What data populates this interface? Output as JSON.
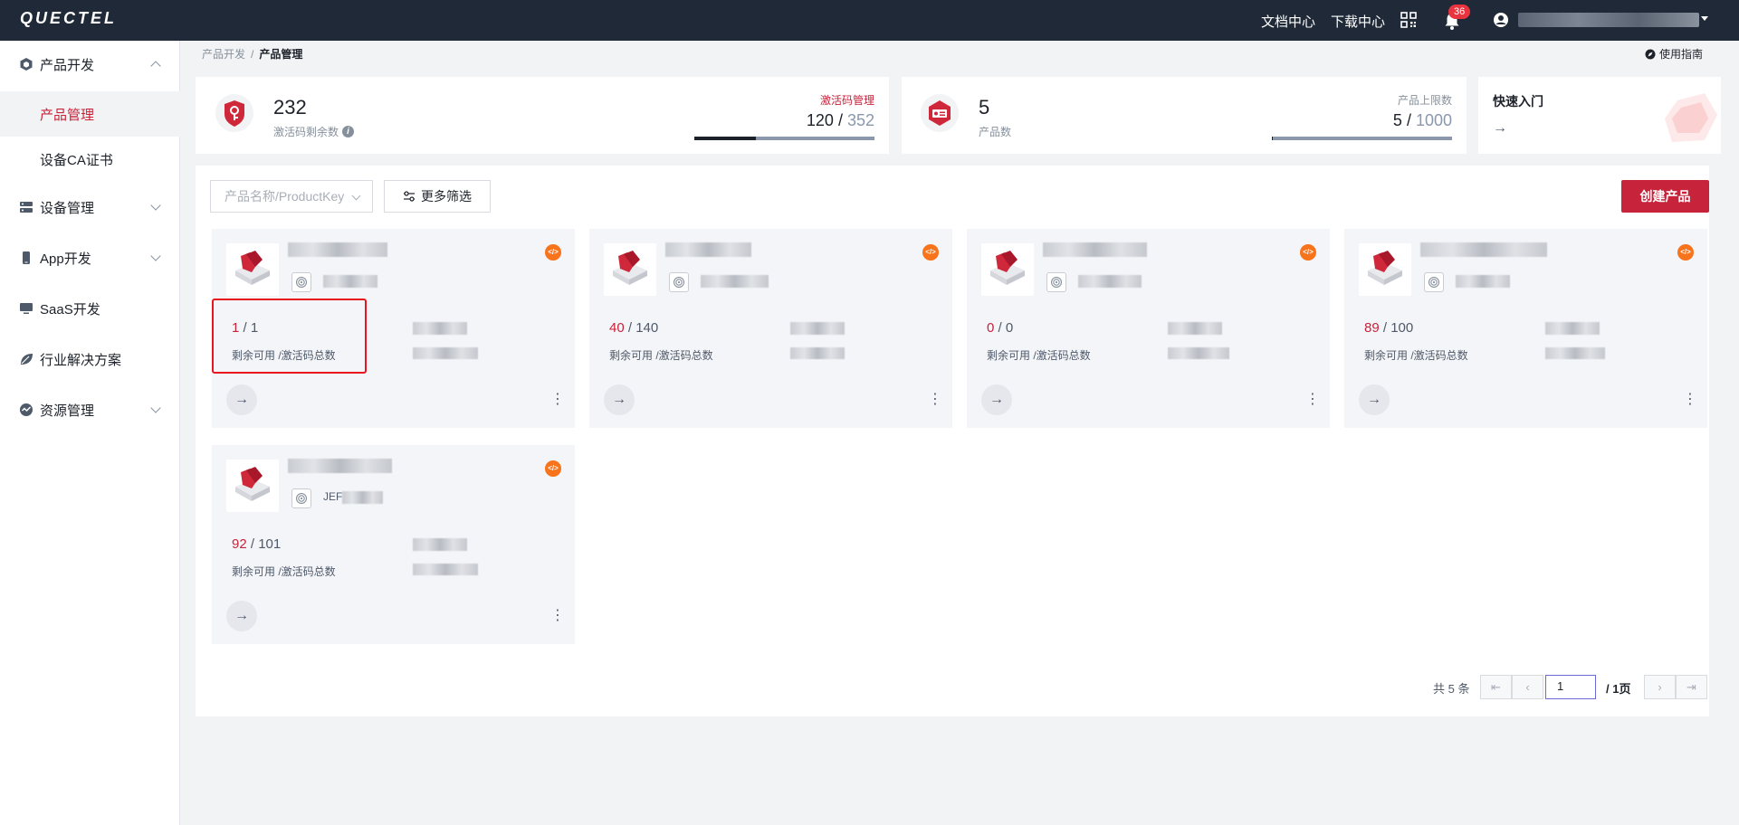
{
  "header": {
    "logo": "QUECTEL",
    "doc_center": "文档中心",
    "download_center": "下载中心",
    "notifications_count": "36",
    "qr_icon": "qr-code-icon",
    "bell_icon": "bell-icon",
    "user_icon": "user-icon"
  },
  "sidebar": {
    "items": [
      {
        "label": "产品开发",
        "icon": "cube-icon",
        "expanded": true
      },
      {
        "label": "产品管理",
        "active": true
      },
      {
        "label": "设备CA证书"
      },
      {
        "label": "设备管理",
        "icon": "server-icon"
      },
      {
        "label": "App开发",
        "icon": "phone-icon"
      },
      {
        "label": "SaaS开发",
        "icon": "monitor-icon"
      },
      {
        "label": "行业解决方案",
        "icon": "leaf-icon"
      },
      {
        "label": "资源管理",
        "icon": "resource-icon"
      }
    ]
  },
  "breadcrumb": {
    "parent": "产品开发",
    "sep": "/",
    "current": "产品管理"
  },
  "guide": "使用指南",
  "stats": {
    "activation": {
      "value": "232",
      "label": "激活码剩余数",
      "link": "激活码管理",
      "used": "120",
      "slash": " / ",
      "total": "352",
      "fill": 0.34
    },
    "products": {
      "value": "5",
      "label": "产品数",
      "limit_label": "产品上限数",
      "used": "5",
      "slash": " / ",
      "total": "1000",
      "fill": 0.005
    },
    "quick": {
      "title": "快速入门",
      "arrow": "→"
    }
  },
  "toolbar": {
    "search_placeholder": "产品名称/ProductKey",
    "more_filter": "更多筛选",
    "create": "创建产品"
  },
  "cards": [
    {
      "name_prefix": "",
      "pkey_prefix": "",
      "remaining": "1",
      "total": "1",
      "label": "剩余可用 /激活码总数"
    },
    {
      "name_prefix": "",
      "pkey_prefix": "",
      "remaining": "40",
      "total": "140",
      "label": "剩余可用 /激活码总数"
    },
    {
      "name_prefix": "",
      "pkey_prefix": "",
      "remaining": "0",
      "total": "0",
      "label": "剩余可用 /激活码总数"
    },
    {
      "name_prefix": "",
      "pkey_prefix": "",
      "remaining": "89",
      "total": "100",
      "label": "剩余可用 /激活码总数"
    },
    {
      "name_prefix": "",
      "pkey_prefix": "JEF",
      "remaining": "92",
      "total": "101",
      "label": "剩余可用 /激活码总数"
    }
  ],
  "card_common": {
    "slash": " / ",
    "go_arrow": "→",
    "more": "⋮",
    "code_symbol": "</>"
  },
  "pagination": {
    "total_text": "共 5 条",
    "first": "⇤",
    "prev": "‹",
    "page": "1",
    "of_text": "/ 1页",
    "next": "›",
    "last": "⇥"
  }
}
